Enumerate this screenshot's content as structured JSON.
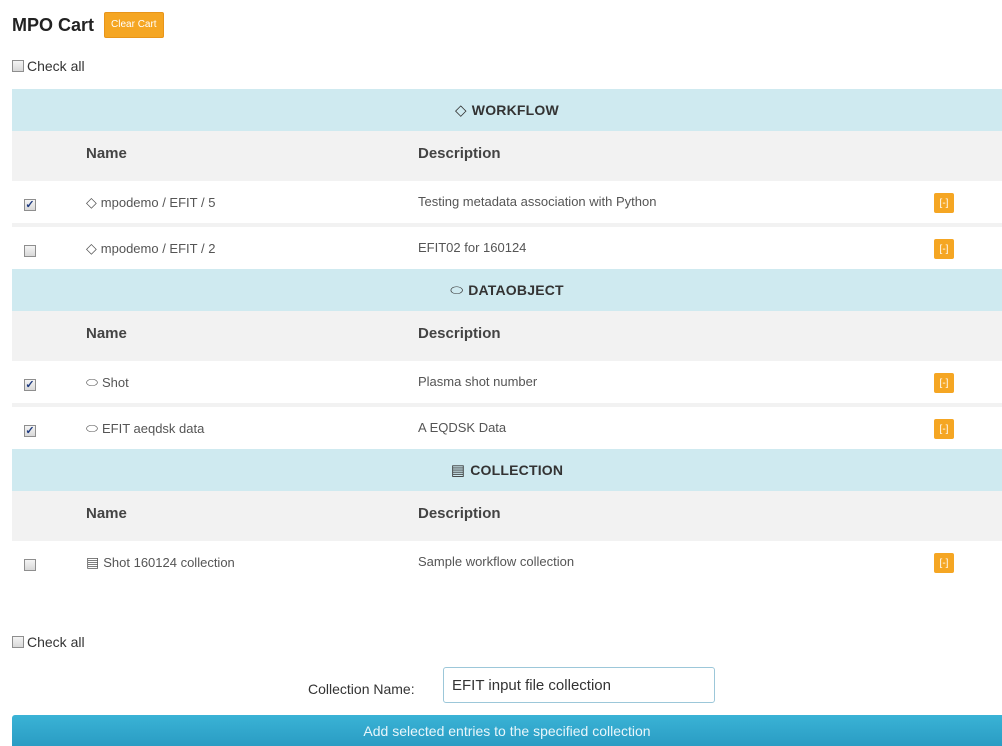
{
  "header": {
    "title": "MPO Cart",
    "clear_label": "Clear Cart"
  },
  "check_all_label": "Check all",
  "columns": {
    "name": "Name",
    "description": "Description"
  },
  "action_label": "[-]",
  "sections": [
    {
      "title": "WORKFLOW",
      "symbol": "◇",
      "rows": [
        {
          "checked": true,
          "symbol": "◇",
          "name": "mpodemo / EFIT / 5",
          "description": "Testing metadata association with Python"
        },
        {
          "checked": false,
          "symbol": "◇",
          "name": "mpodemo / EFIT / 2",
          "description": "EFIT02 for 160124"
        }
      ]
    },
    {
      "title": "DATAOBJECT",
      "symbol": "⬭",
      "rows": [
        {
          "checked": true,
          "symbol": "⬭",
          "name": "Shot",
          "description": "Plasma shot number"
        },
        {
          "checked": true,
          "symbol": "⬭",
          "name": "EFIT aeqdsk data",
          "description": "A EQDSK Data"
        }
      ]
    },
    {
      "title": "COLLECTION",
      "symbol": "▤",
      "rows": [
        {
          "checked": false,
          "symbol": "▤",
          "name": "Shot 160124 collection",
          "description": "Sample workflow collection"
        }
      ]
    }
  ],
  "collection": {
    "label": "Collection Name:",
    "value": "EFIT input file collection"
  },
  "add_button_label": "Add selected entries to the specified collection"
}
